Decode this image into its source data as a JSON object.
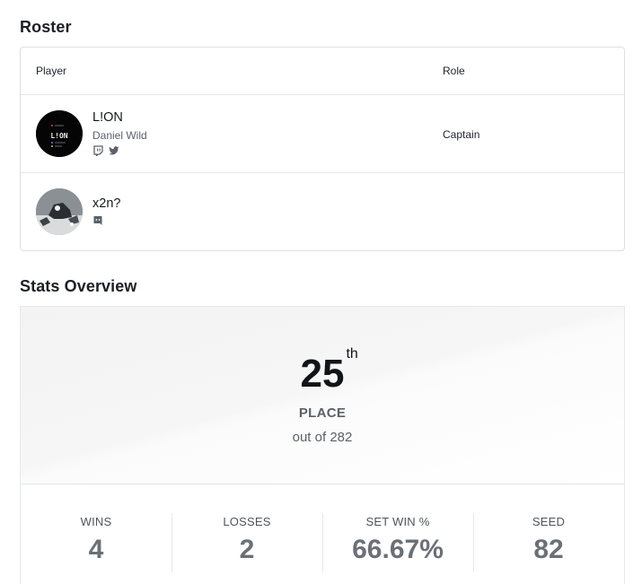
{
  "roster": {
    "title": "Roster",
    "columns": {
      "player": "Player",
      "role": "Role"
    },
    "players": [
      {
        "name": "L!ON",
        "real_name": "Daniel Wild",
        "role": "Captain",
        "socials": [
          "twitch-icon",
          "twitter-icon"
        ]
      },
      {
        "name": "x2n?",
        "real_name": "",
        "role": "",
        "socials": [
          "discord-icon"
        ]
      }
    ]
  },
  "stats": {
    "title": "Stats Overview",
    "place": {
      "value": "25",
      "suffix": "th",
      "label": "PLACE",
      "total": "out of 282"
    },
    "items": [
      {
        "label": "WINS",
        "value": "4"
      },
      {
        "label": "LOSSES",
        "value": "2"
      },
      {
        "label": "SET WIN %",
        "value": "66.67%"
      },
      {
        "label": "SEED",
        "value": "82"
      }
    ]
  },
  "colors": {
    "text": "#1f2329",
    "muted": "#5b6168",
    "stat_value": "#6b7077",
    "border": "#dcdfe3"
  }
}
